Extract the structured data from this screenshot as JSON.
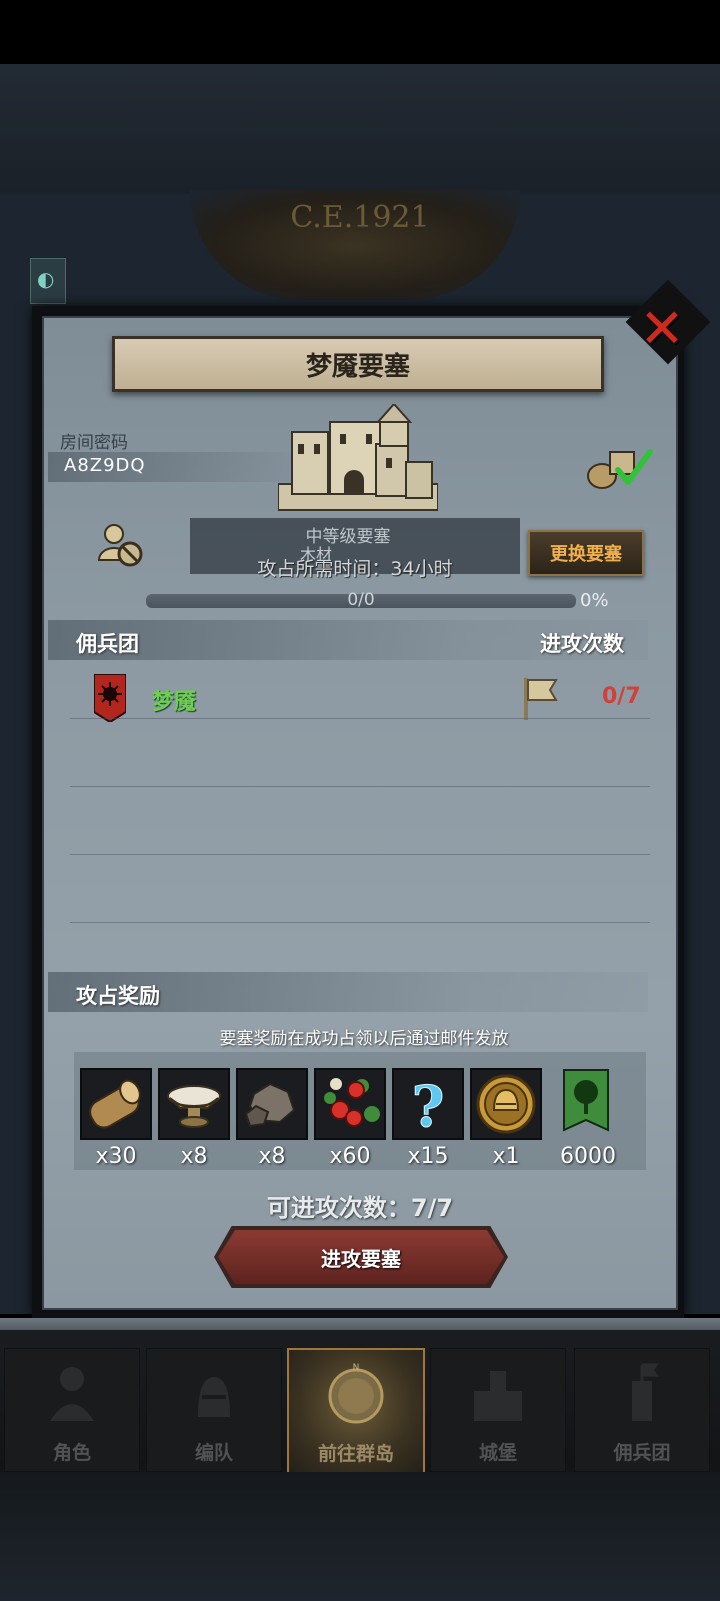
{
  "background": {
    "era": "C.E.1921"
  },
  "modal": {
    "title": "梦魇要塞",
    "room_code_label": "房间密码",
    "room_code": "A8Z9DQ",
    "fortress_level": "中等级要塞",
    "resource_name": "木材",
    "attack_time": "攻占所需时间：34小时",
    "change_button": "更换要塞",
    "progress_text": "0/0",
    "progress_percent": "0%",
    "progress_value": 0
  },
  "mercenaries": {
    "header_left": "佣兵团",
    "header_right": "进攻次数",
    "rows": [
      {
        "name": "梦魇",
        "attacks": "0/7"
      }
    ]
  },
  "rewards": {
    "header": "攻占奖励",
    "note": "要塞奖励在成功占领以后通过邮件发放",
    "items": [
      {
        "icon": "wood-log-icon",
        "amount": "x30"
      },
      {
        "icon": "salt-bowl-icon",
        "amount": "x8"
      },
      {
        "icon": "ore-rock-icon",
        "amount": "x8"
      },
      {
        "icon": "berries-icon",
        "amount": "x60"
      },
      {
        "icon": "mystery-icon",
        "amount": "x15"
      },
      {
        "icon": "helmet-coin-icon",
        "amount": "x1"
      },
      {
        "icon": "tree-banner-icon",
        "amount": "6000"
      }
    ]
  },
  "attack": {
    "count_text": "可进攻次数：7/7",
    "button": "进攻要塞"
  },
  "nav": {
    "items": [
      {
        "label": "角色",
        "active": false
      },
      {
        "label": "编队",
        "active": false
      },
      {
        "label": "前往群岛",
        "active": true
      },
      {
        "label": "城堡",
        "active": false
      },
      {
        "label": "佣兵团",
        "active": false
      }
    ]
  },
  "colors": {
    "accent_green": "#6bd14a",
    "accent_red": "#d0413a",
    "button_orange": "#f0b04a",
    "close_red": "#d02a1f"
  }
}
